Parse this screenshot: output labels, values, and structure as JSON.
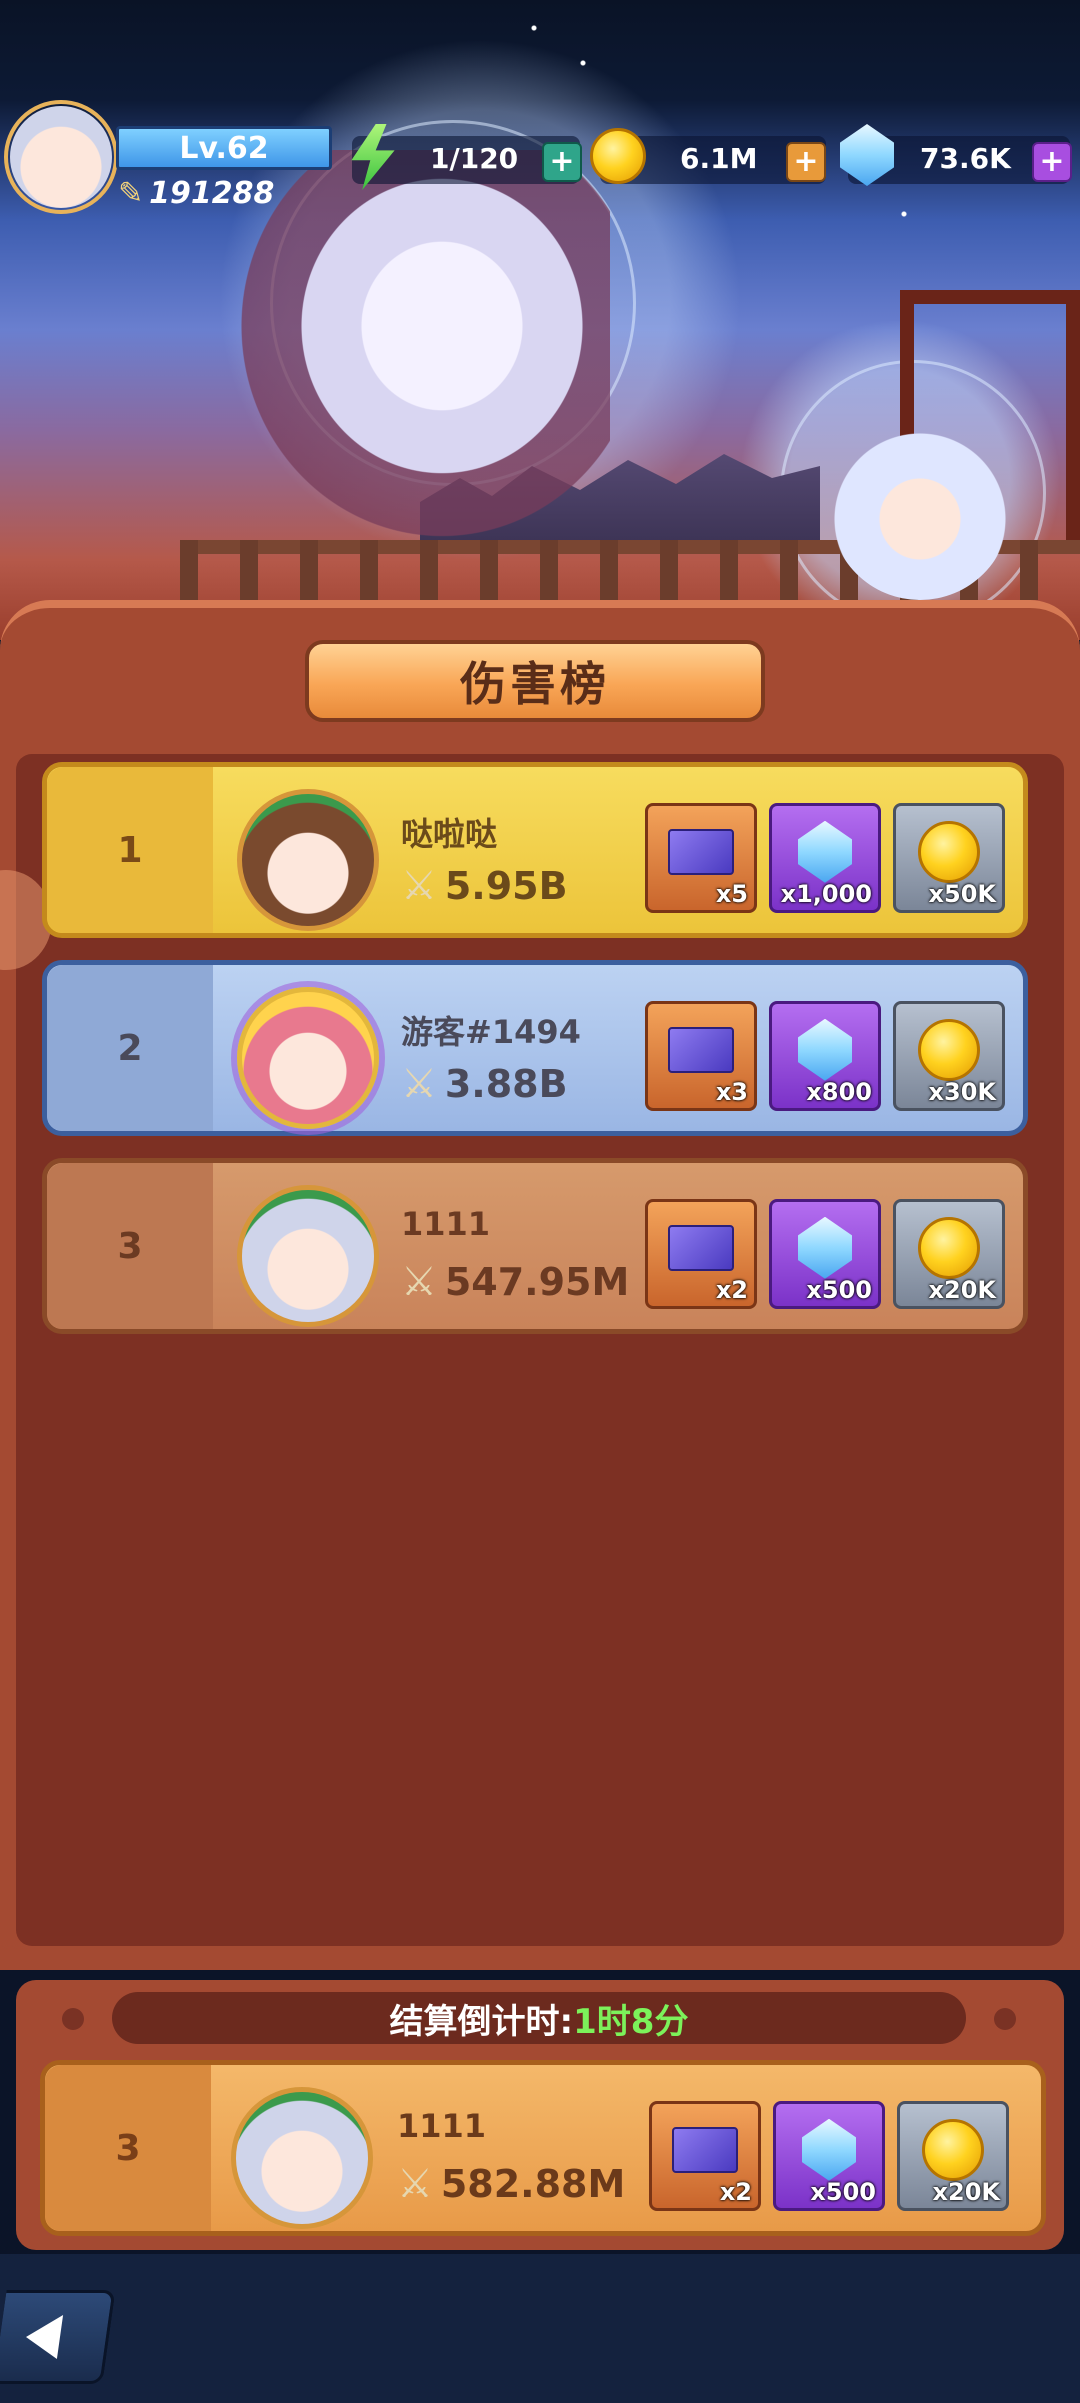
{
  "player": {
    "level": "Lv.62",
    "power": "191288",
    "energy": "1/120",
    "gold": "6.1M",
    "diamonds": "73.6K"
  },
  "leaderboard": {
    "title": "伤害榜",
    "entries": [
      {
        "rank": "1",
        "name": "哒啦哒",
        "damage": "5.95B",
        "rewards": {
          "ticket": "x5",
          "gem": "x1,000",
          "coin": "x50K"
        }
      },
      {
        "rank": "2",
        "name": "游客#1494",
        "damage": "3.88B",
        "rewards": {
          "ticket": "x3",
          "gem": "x800",
          "coin": "x30K"
        }
      },
      {
        "rank": "3",
        "name": "1111",
        "damage": "547.95M",
        "rewards": {
          "ticket": "x2",
          "gem": "x500",
          "coin": "x20K"
        }
      }
    ]
  },
  "countdown": {
    "label": "结算倒计时:",
    "value": "1时8分"
  },
  "my_entry": {
    "rank": "3",
    "name": "1111",
    "damage": "582.88M",
    "rewards": {
      "ticket": "x2",
      "gem": "x500",
      "coin": "x20K"
    }
  },
  "colors": {
    "gold_row": "#f2cc4a",
    "silver_row": "#a9c3ea",
    "bronze_row": "#cf8a5c",
    "countdown_value": "#7cf25a"
  }
}
